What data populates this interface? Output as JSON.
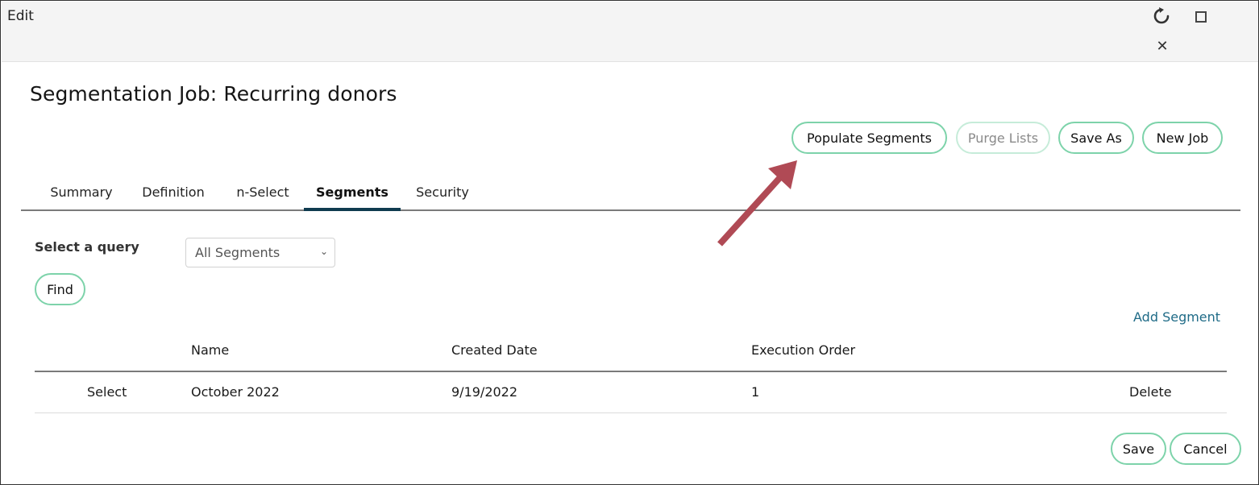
{
  "window": {
    "title": "Edit",
    "icons": [
      "refresh-icon",
      "maximize-icon",
      "close-icon"
    ]
  },
  "page": {
    "title": "Segmentation Job: Recurring donors"
  },
  "toolbar": {
    "populate_label": "Populate Segments",
    "purge_label": "Purge Lists",
    "save_as_label": "Save As",
    "new_job_label": "New Job"
  },
  "tabs": [
    {
      "label": "Summary",
      "active": false
    },
    {
      "label": "Definition",
      "active": false
    },
    {
      "label": "n-Select",
      "active": false
    },
    {
      "label": "Segments",
      "active": true
    },
    {
      "label": "Security",
      "active": false
    }
  ],
  "query": {
    "label": "Select a query",
    "selected": "All Segments",
    "find_label": "Find"
  },
  "segments": {
    "add_label": "Add Segment",
    "columns": [
      "",
      "Name",
      "Created Date",
      "Execution Order",
      ""
    ],
    "rows": [
      {
        "select": "Select",
        "name": "October 2022",
        "created": "9/19/2022",
        "order": "1",
        "delete": "Delete"
      }
    ]
  },
  "footer": {
    "save_label": "Save",
    "cancel_label": "Cancel"
  },
  "annotation": {
    "arrow_color": "#b04a55",
    "points_to": "Populate Segments"
  },
  "colors": {
    "button_border": "#7dd3aa",
    "link": "#1f6b87",
    "active_tab_underline": "#0f3b4f"
  }
}
